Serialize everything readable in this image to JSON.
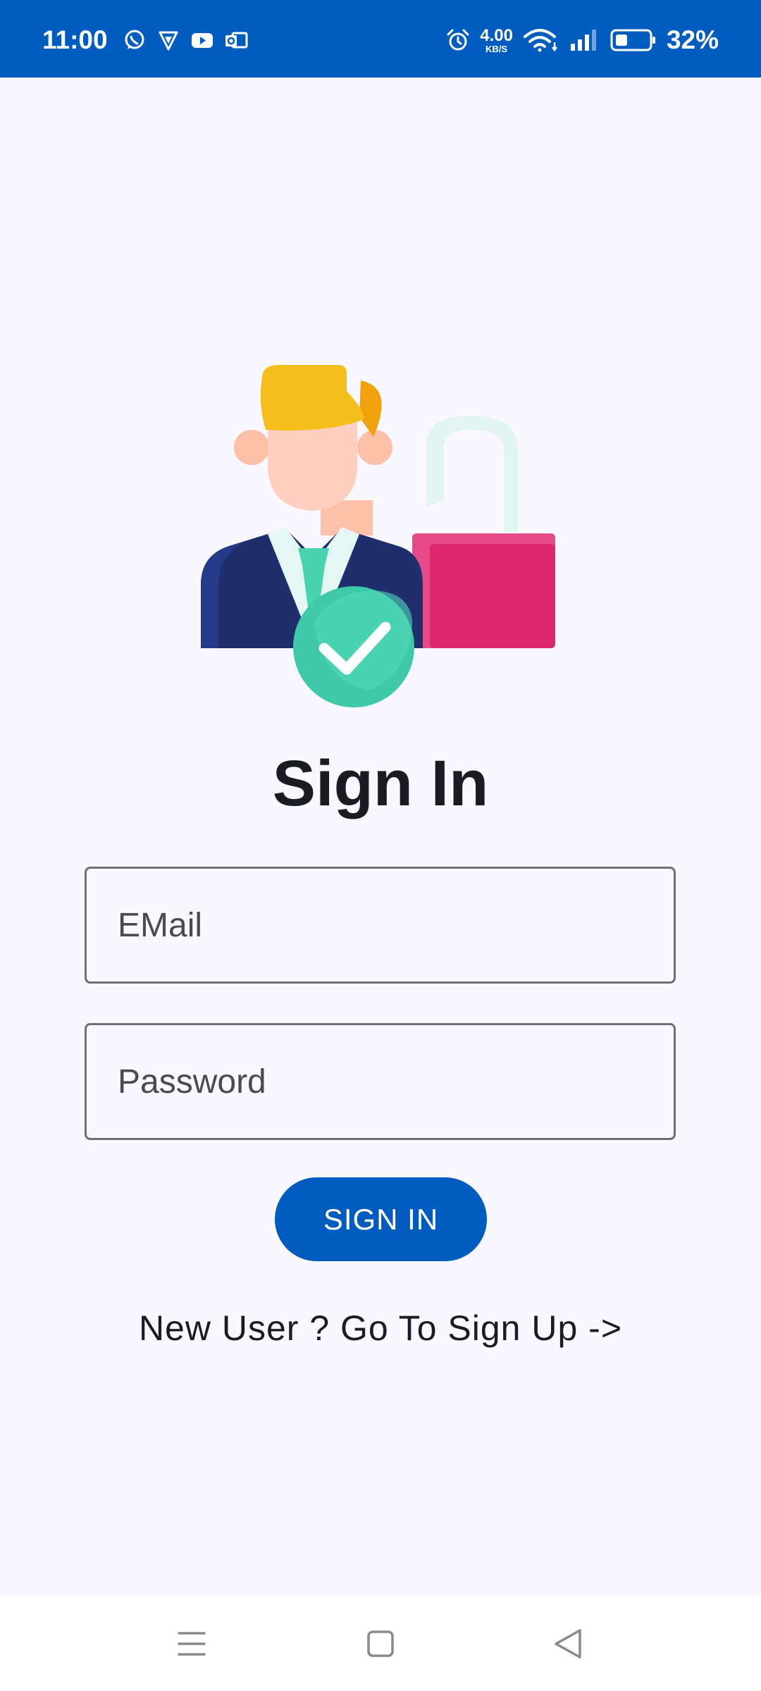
{
  "status_bar": {
    "time": "11:00",
    "network_speed_value": "4.00",
    "network_speed_unit": "KB/S",
    "battery_percent": "32%",
    "left_icons": [
      "whatsapp-icon",
      "vpn-shield-icon",
      "youtube-icon",
      "outlook-icon"
    ],
    "right_icons": [
      "alarm-icon",
      "wifi-icon",
      "signal-icon",
      "battery-icon"
    ],
    "background_color": "#005cbf"
  },
  "illustration": {
    "icon": "user-unlock-verified-illustration"
  },
  "page": {
    "title": "Sign In",
    "background_color": "#f8f8fe"
  },
  "form": {
    "email_placeholder": "EMail",
    "email_value": "",
    "password_placeholder": "Password",
    "password_value": "",
    "signin_label": "SIGN IN",
    "signin_color": "#005cbf",
    "signup_link": "New User ? Go To Sign Up ->"
  },
  "nav_bar": {
    "buttons": [
      "menu-icon",
      "home-icon",
      "back-icon"
    ]
  }
}
